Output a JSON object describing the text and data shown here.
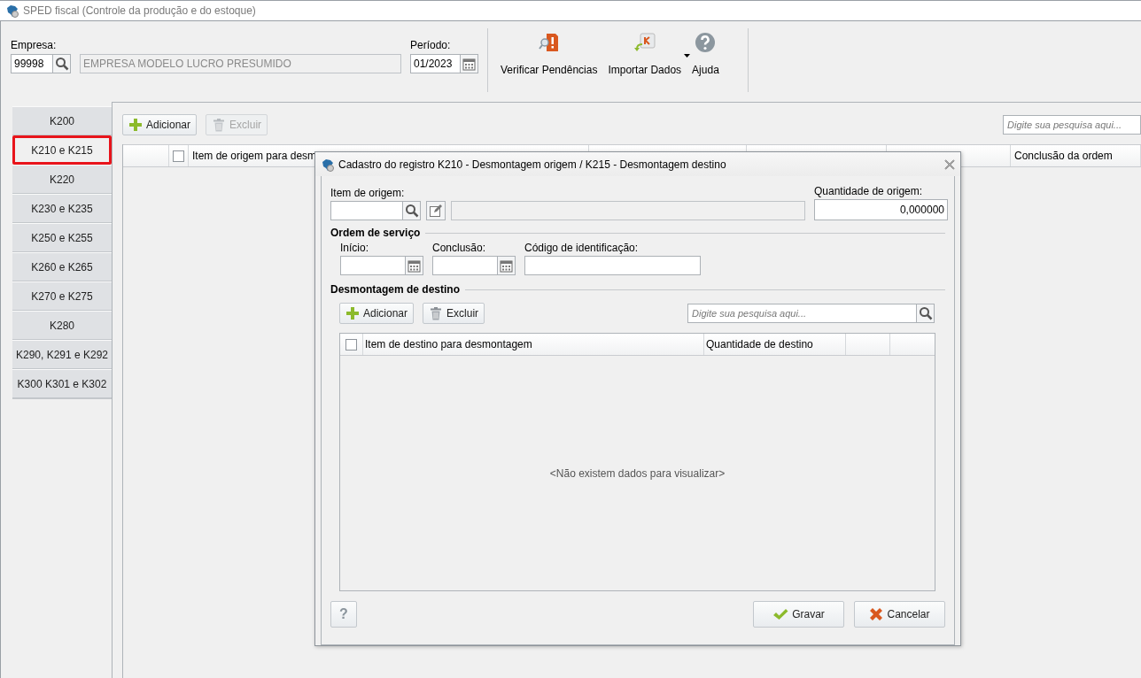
{
  "window": {
    "title": "SPED fiscal (Controle da produção e do estoque)"
  },
  "header": {
    "empresa_label": "Empresa:",
    "empresa_code": "99998",
    "empresa_name": "EMPRESA MODELO LUCRO PRESUMIDO",
    "periodo_label": "Período:",
    "periodo_value": "01/2023"
  },
  "toolbar": [
    {
      "label": "Verificar Pendências",
      "kind": "check",
      "dropdown": false
    },
    {
      "label": "Importar Dados",
      "kind": "import",
      "dropdown": true
    },
    {
      "label": "Ajuda",
      "kind": "help",
      "dropdown": false
    }
  ],
  "tabs": [
    {
      "label": "K200",
      "selected": false
    },
    {
      "label": "K210 e K215",
      "selected": true
    },
    {
      "label": "K220",
      "selected": false
    },
    {
      "label": "K230 e K235",
      "selected": false
    },
    {
      "label": "K250 e K255",
      "selected": false
    },
    {
      "label": "K260 e K265",
      "selected": false
    },
    {
      "label": "K270 e K275",
      "selected": false
    },
    {
      "label": "K280",
      "selected": false
    },
    {
      "label": "K290, K291 e K292",
      "selected": false
    },
    {
      "label": "K300 K301 e K302",
      "selected": false
    }
  ],
  "main": {
    "buttons": [
      {
        "label": "Adicionar",
        "kind": "add",
        "disabled": false
      },
      {
        "label": "Excluir",
        "kind": "delete",
        "disabled": true
      }
    ],
    "search": {
      "placeholder": "Digite sua pesquisa aqui..."
    },
    "select_all_checked": false,
    "columns": [
      {
        "label": "Item de origem para desm"
      },
      {
        "label": "Conclusão da ordem"
      }
    ]
  },
  "dialog": {
    "title": "Cadastro do registro K210 - Desmontagem origem / K215 - Desmontagem destino",
    "item_label": "Item de origem:",
    "quantidade_label": "Quantidade de origem:",
    "quantidade_value": "0,000000",
    "ordem_section": "Ordem de serviço",
    "inicio_label": "Início:",
    "conclusao_label": "Conclusão:",
    "codigo_label": "Código de identificação:",
    "destino_section": "Desmontagem de destino",
    "buttons": [
      {
        "label": "Adicionar",
        "kind": "add",
        "disabled": false
      },
      {
        "label": "Excluir",
        "kind": "delete",
        "disabled": false
      }
    ],
    "search": {
      "placeholder": "Digite sua pesquisa aqui..."
    },
    "select_all_checked": false,
    "columns": [
      {
        "label": "Item de destino para desmontagem"
      },
      {
        "label": "Quantidade de destino"
      }
    ],
    "empty_message": "<Não existem dados para visualizar>",
    "help_button": "?",
    "footer_buttons": [
      {
        "label": "Gravar",
        "kind": "save"
      },
      {
        "label": "Cancelar",
        "kind": "cancel"
      }
    ]
  }
}
